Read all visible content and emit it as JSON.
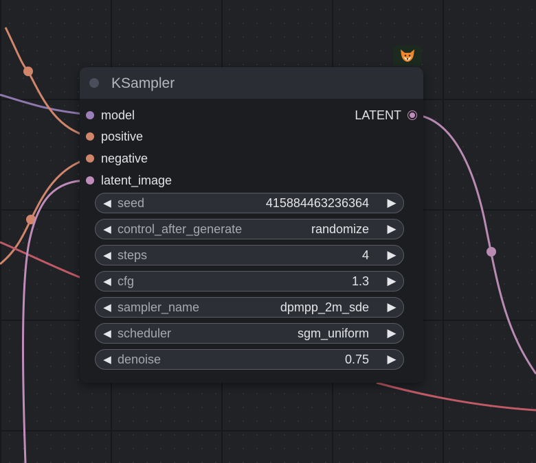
{
  "node": {
    "title": "KSampler",
    "badge_icon": "fox-icon",
    "inputs": [
      {
        "label": "model",
        "color": "#9a7fb8"
      },
      {
        "label": "positive",
        "color": "#d0856a"
      },
      {
        "label": "negative",
        "color": "#d0856a"
      },
      {
        "label": "latent_image",
        "color": "#c08dbb"
      }
    ],
    "outputs": [
      {
        "label": "LATENT",
        "color": "#c08dbb"
      }
    ],
    "widgets": [
      {
        "name": "seed",
        "value": "415884463236364"
      },
      {
        "name": "control_after_generate",
        "value": "randomize"
      },
      {
        "name": "steps",
        "value": "4"
      },
      {
        "name": "cfg",
        "value": "1.3"
      },
      {
        "name": "sampler_name",
        "value": "dpmpp_2m_sde"
      },
      {
        "name": "scheduler",
        "value": "sgm_uniform"
      },
      {
        "name": "denoise",
        "value": "0.75"
      }
    ],
    "widget_arrows": {
      "left": "◀",
      "right": "▶"
    }
  },
  "colors": {
    "model_link": "#8e78ae",
    "conditioning_link": "#d1866c",
    "latent_link": "#b98bb3",
    "red_link": "#c05a66"
  }
}
